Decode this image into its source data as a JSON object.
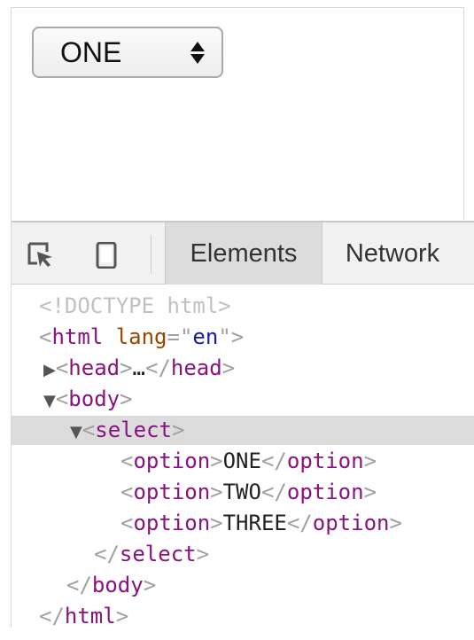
{
  "page": {
    "select": {
      "value": "ONE"
    }
  },
  "devtools": {
    "tabs": [
      {
        "label": "Elements"
      },
      {
        "label": "Network"
      }
    ],
    "tree": {
      "doctype": "<!DOCTYPE html>",
      "html_open": "html",
      "html_attr_name": "lang",
      "html_attr_value": "en",
      "head": "head",
      "head_ellipsis": "…",
      "body": "body",
      "select": "select",
      "option_tag": "option",
      "options": [
        "ONE",
        "TWO",
        "THREE"
      ],
      "close_select": "select",
      "close_body": "body",
      "close_html": "html"
    }
  }
}
